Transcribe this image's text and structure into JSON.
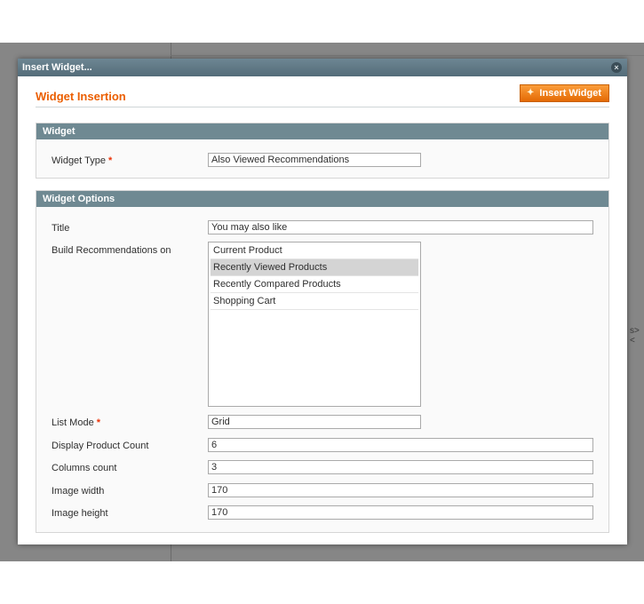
{
  "modal": {
    "title": "Insert Widget...",
    "close_icon": "×"
  },
  "page": {
    "title": "Widget Insertion",
    "insert_button_label": "Insert Widget"
  },
  "widget_section": {
    "legend": "Widget",
    "type_label": "Widget Type",
    "required_mark": "*",
    "type_value": "Also Viewed Recommendations"
  },
  "options_section": {
    "legend": "Widget Options",
    "title_label": "Title",
    "title_value": "You may also like",
    "build_label": "Build Recommendations on",
    "build_options": [
      "Current Product",
      "Recently Viewed Products",
      "Recently Compared Products",
      "Shopping Cart"
    ],
    "build_selected": "Recently Viewed Products",
    "list_mode_label": "List Mode",
    "list_mode_value": "Grid",
    "product_count_label": "Display Product Count",
    "product_count_value": "6",
    "columns_label": "Columns count",
    "columns_value": "3",
    "image_width_label": "Image width",
    "image_width_value": "170",
    "image_height_label": "Image height",
    "image_height_value": "170"
  },
  "background": {
    "fragment_text": "s><"
  },
  "colors": {
    "accent": "#eb5e00",
    "titlebar": "#5f7885",
    "legend": "#6f8992"
  }
}
